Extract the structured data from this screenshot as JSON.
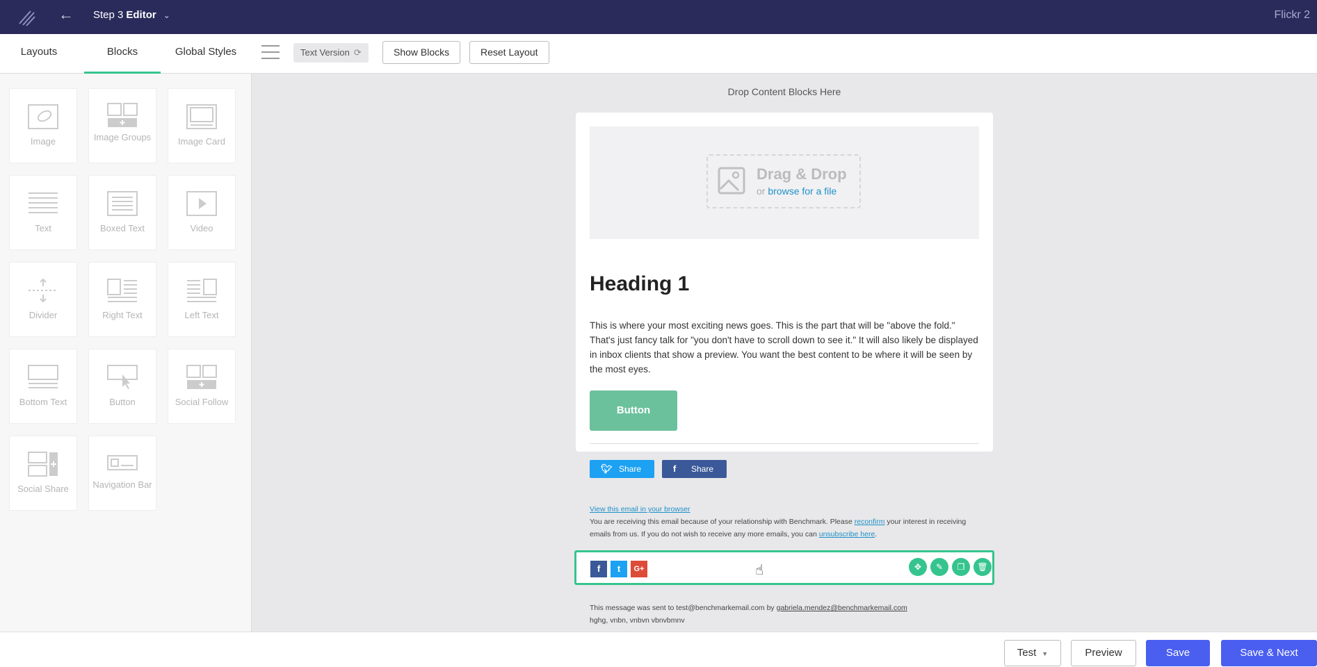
{
  "topbar": {
    "step_label": "Step 3",
    "step_name": "Editor",
    "campaign_name": "Flickr 2"
  },
  "toolbar": {
    "tabs": [
      {
        "label": "Layouts"
      },
      {
        "label": "Blocks",
        "active": true
      },
      {
        "label": "Global Styles"
      }
    ],
    "text_version": "Text Version",
    "show_blocks": "Show Blocks",
    "reset_layout": "Reset Layout"
  },
  "sidebar": {
    "blocks": [
      {
        "label": "Image",
        "icon": "image-icon"
      },
      {
        "label": "Image Groups",
        "icon": "image-groups-icon"
      },
      {
        "label": "Image Card",
        "icon": "image-card-icon"
      },
      {
        "label": "Text",
        "icon": "text-icon"
      },
      {
        "label": "Boxed Text",
        "icon": "boxed-text-icon"
      },
      {
        "label": "Video",
        "icon": "video-icon"
      },
      {
        "label": "Divider",
        "icon": "divider-icon"
      },
      {
        "label": "Right Text",
        "icon": "right-text-icon"
      },
      {
        "label": "Left Text",
        "icon": "left-text-icon"
      },
      {
        "label": "Bottom Text",
        "icon": "bottom-text-icon"
      },
      {
        "label": "Button",
        "icon": "button-icon"
      },
      {
        "label": "Social Follow",
        "icon": "social-follow-icon"
      },
      {
        "label": "Social Share",
        "icon": "social-share-icon"
      },
      {
        "label": "Navigation Bar",
        "icon": "navigation-bar-icon"
      }
    ]
  },
  "canvas": {
    "drop_hint": "Drop Content Blocks Here",
    "image_drop": {
      "title": "Drag & Drop",
      "or": "or",
      "browse": "browse for a file"
    },
    "heading": "Heading 1",
    "paragraph": "This is where your most exciting news goes. This is the part that will be \"above the fold.\" That's just fancy talk for \"you don't have to scroll down to see it.\" It will also likely be displayed in inbox clients that show a preview. You want the best content to be where it will be seen by the most eyes.",
    "button_label": "Button",
    "share": {
      "twitter": "Share",
      "facebook": "Share"
    },
    "footer": {
      "view_browser": "View this email in your browser",
      "line1_before": "You are receiving this email because of your relationship with Benchmark. Please ",
      "reconfirm": "reconfirm",
      "line1_after": " your interest in receiving emails from us. If you do not wish to receive any more emails, you can ",
      "unsubscribe": "unsubscribe here",
      "period": "."
    },
    "social_icons": {
      "facebook": "f",
      "twitter": "t",
      "google": "G+"
    },
    "sent": {
      "prefix": "This message was sent to test@benchmarkemail.com by ",
      "sender": "gabriela.mendez@benchmarkemail.com",
      "address": "hghg, vnbn, vnbvn vbnvbmnv"
    }
  },
  "bottombar": {
    "test": "Test",
    "preview": "Preview",
    "save": "Save",
    "save_next": "Save & Next"
  },
  "colors": {
    "topbar": "#2a2b5b",
    "accent_green": "#35c48e",
    "button_green": "#6cc19d",
    "primary_blue": "#4a5ef0",
    "twitter": "#1da1f2",
    "facebook": "#3b5998",
    "google": "#dd4b39"
  }
}
